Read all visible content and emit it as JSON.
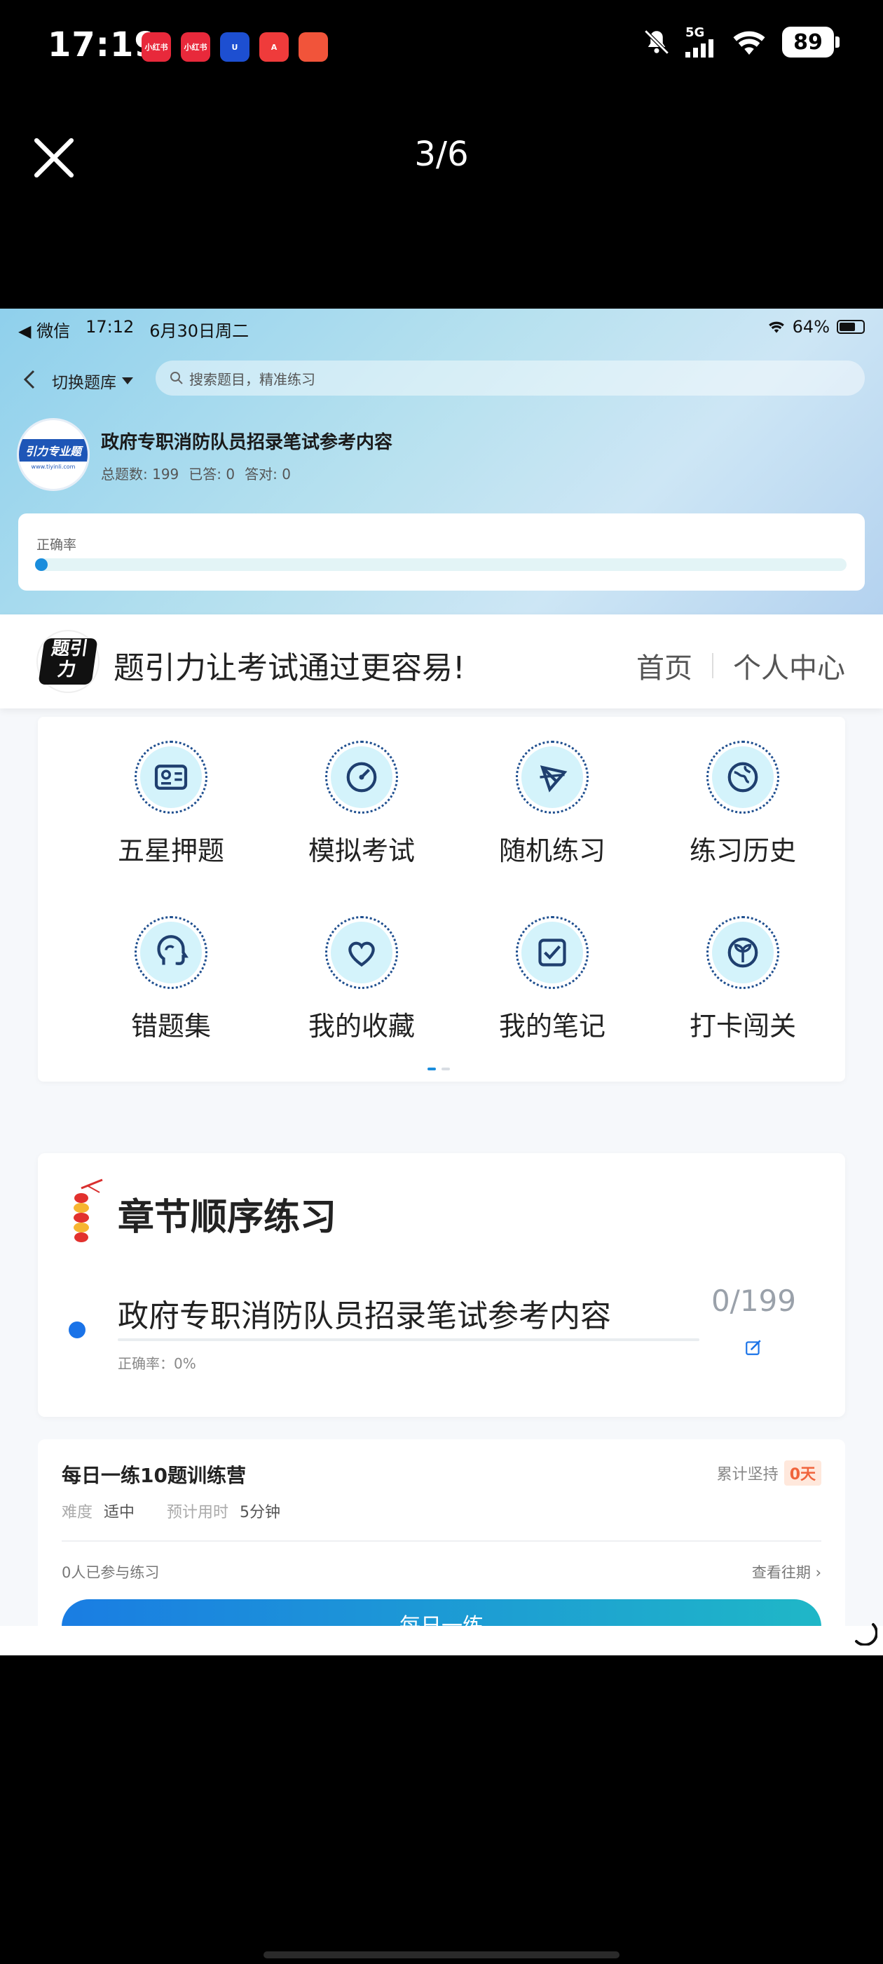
{
  "os_status": {
    "time": "17:19",
    "apps": [
      {
        "name": "xiaohongshu-app-icon",
        "label": "小红书",
        "color": "#e8293b"
      },
      {
        "name": "xiaohongshu-app-icon-2",
        "label": "小红书",
        "color": "#e8293b"
      },
      {
        "name": "u-app-icon",
        "label": "U",
        "color": "#1d4fd1"
      },
      {
        "name": "a-app-icon",
        "label": "A",
        "color": "#ef3b3b"
      },
      {
        "name": "red-app-icon",
        "label": "",
        "color": "#f1543a"
      }
    ],
    "signal": "5G",
    "battery": "89"
  },
  "viewer": {
    "counter": "3/6"
  },
  "inner_status": {
    "back_app": "◀ 微信",
    "time": "17:12",
    "date": "6月30日周二",
    "battery": "64%"
  },
  "nav": {
    "switch_bank": "切换题库",
    "search_placeholder": "搜索题目，精准练习"
  },
  "bank": {
    "logo_text": "引力专业题",
    "logo_small": "www.tiyinli.com",
    "title": "政府专职消防队员招录笔试参考内容",
    "total_label": "总题数:",
    "total": "199",
    "answered_label": "已答:",
    "answered": "0",
    "correct_label": "答对:",
    "correct": "0"
  },
  "accuracy": {
    "label": "正确率",
    "fraction": 0
  },
  "brand": {
    "logo_text": "题引力",
    "slogan": "题引力让考试通过更容易!",
    "nav_home": "首页",
    "nav_profile": "个人中心"
  },
  "functions": [
    {
      "label": "五星押题",
      "icon": "id-card-icon"
    },
    {
      "label": "模拟考试",
      "icon": "gauge-icon"
    },
    {
      "label": "随机练习",
      "icon": "shuffle-icon"
    },
    {
      "label": "练习历史",
      "icon": "globe-icon"
    },
    {
      "label": "错题集",
      "icon": "head-icon"
    },
    {
      "label": "我的收藏",
      "icon": "heart-icon"
    },
    {
      "label": "我的笔记",
      "icon": "note-check-icon"
    },
    {
      "label": "打卡闯关",
      "icon": "sprout-icon"
    }
  ],
  "chapter": {
    "title": "章节顺序练习",
    "item_name": "政府专职消防队员招录笔试参考内容",
    "item_accuracy": "正确率：0%",
    "item_count": "0/199"
  },
  "daily": {
    "title": "每日一练10题训练营",
    "streak_label": "累计坚持",
    "streak_value": "0天",
    "difficulty_label": "难度",
    "difficulty": "适中",
    "time_label": "预计用时",
    "time": "5分钟",
    "joined": "0人已参与练习",
    "history": "查看往期 ›",
    "button": "每日一练"
  },
  "colors": {
    "accent": "#1a8ddc",
    "icon_fill": "#d4f3fb",
    "icon_ring": "#1f4f8f",
    "streak": "#f0643c"
  }
}
